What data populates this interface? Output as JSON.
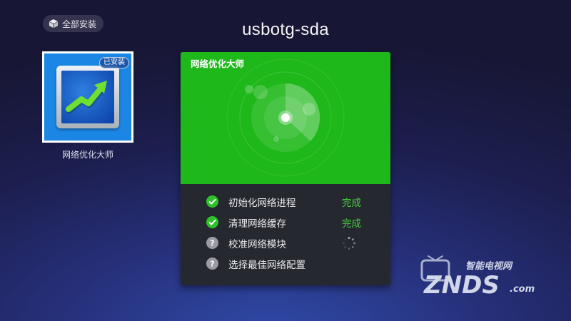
{
  "toolbar": {
    "install_all_label": "全部安装",
    "install_all_icon": "box-icon"
  },
  "page_title": "usbotg-sda",
  "app": {
    "name": "网络优化大师",
    "badge": "已安装",
    "icon": "chart-trend-icon"
  },
  "panel": {
    "title": "网络优化大师",
    "accent_color": "#1fb81a",
    "tasks": [
      {
        "label": "初始化网络进程",
        "status": "done",
        "status_text": "完成",
        "icon": "check-circle-icon"
      },
      {
        "label": "清理网络缓存",
        "status": "done",
        "status_text": "完成",
        "icon": "check-circle-icon"
      },
      {
        "label": "校准网络模块",
        "status": "loading",
        "status_text": "",
        "icon": "question-circle-icon"
      },
      {
        "label": "选择最佳网络配置",
        "status": "pending",
        "status_text": "",
        "icon": "question-circle-icon"
      }
    ]
  },
  "watermark": {
    "line1": "智能电视网",
    "line2": "ZNDS",
    "line3": ".com"
  }
}
